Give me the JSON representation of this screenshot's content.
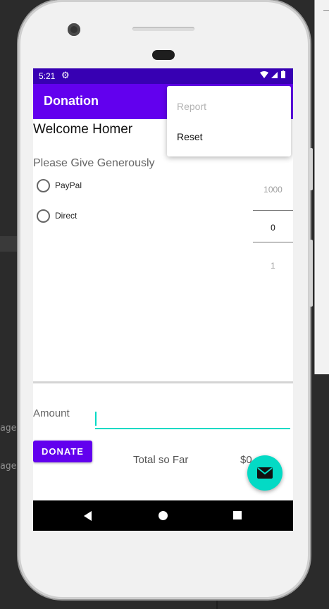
{
  "ide": {
    "side_text_1": "ageC",
    "side_text_2": "ageC"
  },
  "status_bar": {
    "time": "5:21",
    "settings_icon": "gear-icon",
    "indicators": "wifi signal battery"
  },
  "app_bar": {
    "title": "Donation"
  },
  "overflow_menu": {
    "items": [
      {
        "label": "Report",
        "enabled": false
      },
      {
        "label": "Reset",
        "enabled": true
      }
    ]
  },
  "main": {
    "welcome": "Welcome Homer",
    "prompt": "Please Give Generously",
    "payment_methods": [
      {
        "label": "PayPal",
        "selected": false
      },
      {
        "label": "Direct",
        "selected": false
      }
    ],
    "number_picker": {
      "above": "1000",
      "current": "0",
      "below": "1"
    }
  },
  "form": {
    "amount_label": "Amount",
    "amount_value": "",
    "donate_label": "DONATE",
    "total_label": "Total so Far",
    "total_value": "$0"
  },
  "fab": {
    "icon": "email-icon",
    "color": "#03dac5"
  },
  "colors": {
    "primary": "#6200ee",
    "primary_dark": "#3700b3",
    "accent": "#03dac5"
  }
}
